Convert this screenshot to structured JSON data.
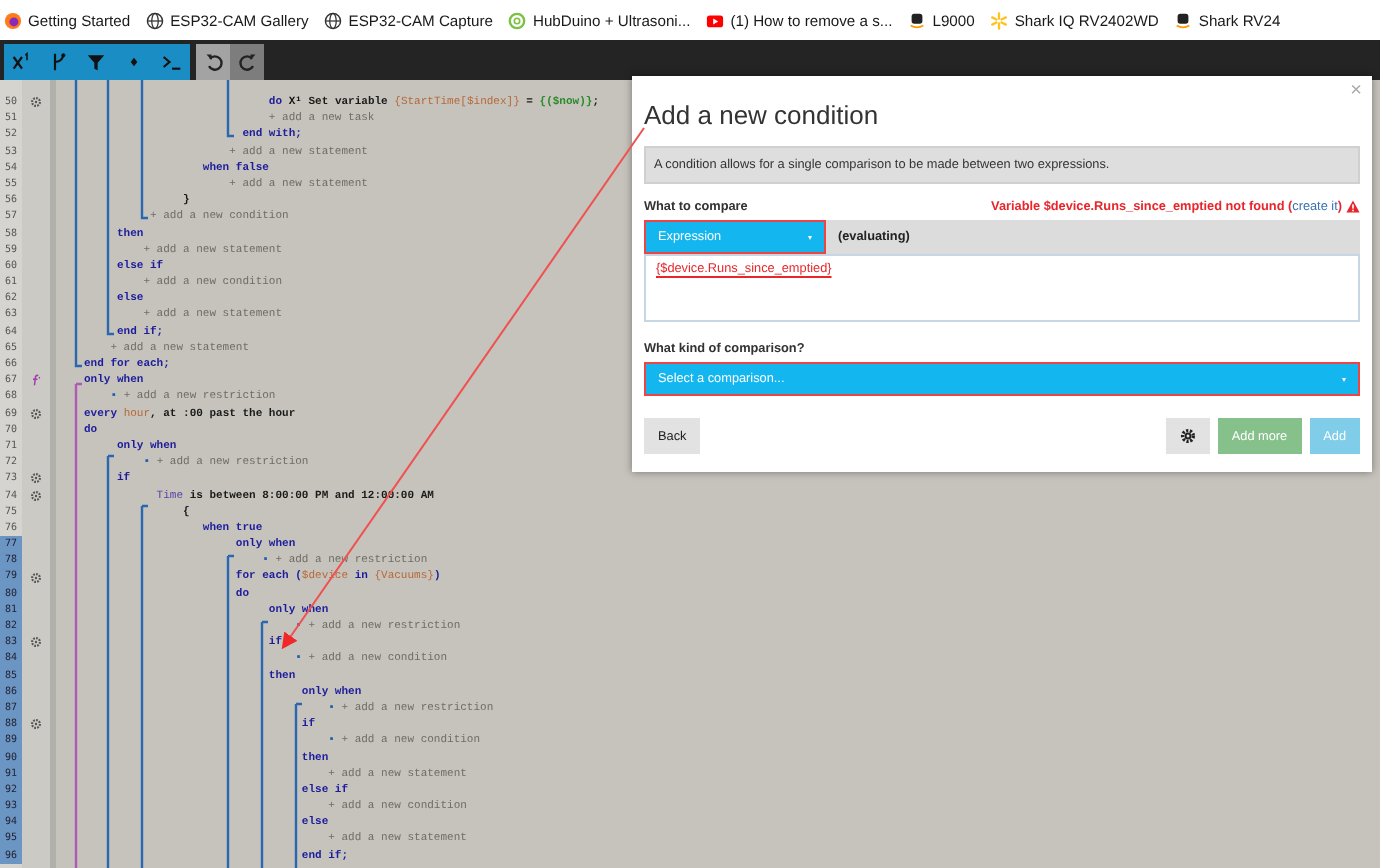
{
  "bookmarks": [
    {
      "kind": "firefox",
      "label": "Getting Started"
    },
    {
      "kind": "globe",
      "label": "ESP32-CAM Gallery"
    },
    {
      "kind": "globe",
      "label": "ESP32-CAM Capture"
    },
    {
      "kind": "ring",
      "label": "HubDuino + Ultrasoni..."
    },
    {
      "kind": "video",
      "label": "(1) How to remove a s..."
    },
    {
      "kind": "amazon",
      "label": "L9000"
    },
    {
      "kind": "spark",
      "label": "Shark IQ RV2402WD"
    },
    {
      "kind": "amazon",
      "label": "Shark RV24"
    }
  ],
  "toolbar": {
    "groups": [
      {
        "kind": "insert",
        "buttons": [
          {
            "kind": "variable"
          },
          {
            "kind": "branch"
          },
          {
            "kind": "filter"
          },
          {
            "kind": "diamond"
          },
          {
            "kind": "terminal"
          }
        ]
      },
      {
        "kind": "history",
        "buttons": [
          {
            "kind": "undo"
          },
          {
            "kind": "redo"
          }
        ]
      }
    ]
  },
  "editor": {
    "lines": [
      {
        "number": "50",
        "marker": {
          "kind": "gear"
        },
        "highlighted": false,
        "parts": [
          {
            "kind": "keyword",
            "text": "                            do "
          },
          {
            "kind": "icon",
            "text": "X¹"
          },
          {
            "kind": "text",
            "text": " Set variable "
          },
          {
            "kind": "var",
            "text": "{StartTime[$index]}"
          },
          {
            "kind": "text",
            "text": " = "
          },
          {
            "kind": "value",
            "text": "{($now)}"
          },
          {
            "kind": "text",
            "text": ";"
          }
        ]
      },
      {
        "number": "51",
        "highlighted": false,
        "parts": [
          {
            "kind": "add",
            "text": "                            + add a new task"
          }
        ]
      },
      {
        "number": "52",
        "highlighted": false,
        "parts": [
          {
            "kind": "keyword",
            "text": "                        end with;"
          }
        ]
      },
      {
        "number": "53",
        "highlighted": false,
        "parts": [
          {
            "kind": "add",
            "text": "                      + add a new statement"
          }
        ]
      },
      {
        "number": "54",
        "highlighted": false,
        "parts": [
          {
            "kind": "keyword",
            "text": "                  when false"
          }
        ]
      },
      {
        "number": "55",
        "highlighted": false,
        "parts": [
          {
            "kind": "add",
            "text": "                      + add a new statement"
          }
        ]
      },
      {
        "number": "56",
        "highlighted": false,
        "parts": [
          {
            "kind": "text",
            "text": "               }"
          }
        ]
      },
      {
        "number": "57",
        "highlighted": false,
        "parts": [
          {
            "kind": "add",
            "text": "          + add a new condition"
          }
        ]
      },
      {
        "number": "58",
        "highlighted": false,
        "parts": [
          {
            "kind": "keyword",
            "text": "     then"
          }
        ]
      },
      {
        "number": "59",
        "highlighted": false,
        "parts": [
          {
            "kind": "add",
            "text": "         + add a new statement"
          }
        ]
      },
      {
        "number": "60",
        "highlighted": false,
        "parts": [
          {
            "kind": "keyword",
            "text": "     else if"
          }
        ]
      },
      {
        "number": "61",
        "highlighted": false,
        "parts": [
          {
            "kind": "add",
            "text": "         + add a new condition"
          }
        ]
      },
      {
        "number": "62",
        "highlighted": false,
        "parts": [
          {
            "kind": "keyword",
            "text": "     else"
          }
        ]
      },
      {
        "number": "63",
        "highlighted": false,
        "parts": [
          {
            "kind": "add",
            "text": "         + add a new statement"
          }
        ]
      },
      {
        "number": "64",
        "highlighted": false,
        "parts": [
          {
            "kind": "keyword",
            "text": "     end if;"
          }
        ]
      },
      {
        "number": "65",
        "highlighted": false,
        "parts": [
          {
            "kind": "add",
            "text": "    + add a new statement"
          }
        ]
      },
      {
        "number": "66",
        "highlighted": false,
        "parts": [
          {
            "kind": "keyword",
            "text": "end for each;"
          }
        ]
      },
      {
        "number": "67",
        "marker": {
          "kind": "function"
        },
        "highlighted": false,
        "parts": [
          {
            "kind": "keyword",
            "text": "only when"
          }
        ]
      },
      {
        "number": "68",
        "highlighted": false,
        "parts": [
          {
            "kind": "bullet",
            "text": "    ▪"
          },
          {
            "kind": "add",
            "text": " + add a new restriction"
          }
        ]
      },
      {
        "number": "69",
        "marker": {
          "kind": "gear"
        },
        "highlighted": false,
        "parts": [
          {
            "kind": "keyword",
            "text": "every "
          },
          {
            "kind": "var",
            "text": "hour"
          },
          {
            "kind": "text",
            "text": ", at :00 past the hour"
          }
        ]
      },
      {
        "number": "70",
        "highlighted": false,
        "parts": [
          {
            "kind": "keyword",
            "text": "do"
          }
        ]
      },
      {
        "number": "71",
        "highlighted": false,
        "parts": [
          {
            "kind": "keyword",
            "text": "     only when"
          }
        ]
      },
      {
        "number": "72",
        "highlighted": false,
        "parts": [
          {
            "kind": "bullet",
            "text": "         ▪"
          },
          {
            "kind": "add",
            "text": " + add a new restriction"
          }
        ]
      },
      {
        "number": "73",
        "marker": {
          "kind": "gear"
        },
        "highlighted": false,
        "parts": [
          {
            "kind": "keyword",
            "text": "     if"
          }
        ]
      },
      {
        "number": "74",
        "marker": {
          "kind": "gear"
        },
        "highlighted": false,
        "parts": [
          {
            "kind": "device",
            "text": "           Time"
          },
          {
            "kind": "text",
            "text": " is between 8:00:00 PM and 12:00:00 AM"
          }
        ]
      },
      {
        "number": "75",
        "highlighted": false,
        "parts": [
          {
            "kind": "text",
            "text": "               {"
          }
        ]
      },
      {
        "number": "76",
        "highlighted": false,
        "parts": [
          {
            "kind": "keyword",
            "text": "                  when true"
          }
        ]
      },
      {
        "number": "77",
        "highlighted": true,
        "parts": [
          {
            "kind": "keyword",
            "text": "                       only when"
          }
        ]
      },
      {
        "number": "78",
        "highlighted": true,
        "parts": [
          {
            "kind": "bullet",
            "text": "                           ▪"
          },
          {
            "kind": "add",
            "text": " + add a new restriction"
          }
        ]
      },
      {
        "number": "79",
        "marker": {
          "kind": "gear"
        },
        "highlighted": true,
        "parts": [
          {
            "kind": "keyword",
            "text": "                       for each ("
          },
          {
            "kind": "var",
            "text": "$device"
          },
          {
            "kind": "keyword",
            "text": " in "
          },
          {
            "kind": "var",
            "text": "{Vacuums}"
          },
          {
            "kind": "keyword",
            "text": ")"
          }
        ]
      },
      {
        "number": "80",
        "highlighted": true,
        "parts": [
          {
            "kind": "keyword",
            "text": "                       do"
          }
        ]
      },
      {
        "number": "81",
        "highlighted": true,
        "parts": [
          {
            "kind": "keyword",
            "text": "                            only when"
          }
        ]
      },
      {
        "number": "82",
        "highlighted": true,
        "parts": [
          {
            "kind": "bullet",
            "text": "                                ▪"
          },
          {
            "kind": "add",
            "text": " + add a new restriction"
          }
        ]
      },
      {
        "number": "83",
        "marker": {
          "kind": "gear"
        },
        "highlighted": true,
        "parts": [
          {
            "kind": "keyword",
            "text": "                            if"
          }
        ]
      },
      {
        "number": "84",
        "highlighted": true,
        "parts": [
          {
            "kind": "bullet",
            "text": "                                ▪"
          },
          {
            "kind": "add",
            "text": " + add a new condition"
          }
        ]
      },
      {
        "number": "85",
        "highlighted": true,
        "parts": [
          {
            "kind": "keyword",
            "text": "                            then"
          }
        ]
      },
      {
        "number": "86",
        "highlighted": true,
        "parts": [
          {
            "kind": "keyword",
            "text": "                                 only when"
          }
        ]
      },
      {
        "number": "87",
        "highlighted": true,
        "parts": [
          {
            "kind": "bullet",
            "text": "                                     ▪"
          },
          {
            "kind": "add",
            "text": " + add a new restriction"
          }
        ]
      },
      {
        "number": "88",
        "marker": {
          "kind": "gear"
        },
        "highlighted": true,
        "parts": [
          {
            "kind": "keyword",
            "text": "                                 if"
          }
        ]
      },
      {
        "number": "89",
        "highlighted": true,
        "parts": [
          {
            "kind": "bullet",
            "text": "                                     ▪"
          },
          {
            "kind": "add",
            "text": " + add a new condition"
          }
        ]
      },
      {
        "number": "90",
        "highlighted": true,
        "parts": [
          {
            "kind": "keyword",
            "text": "                                 then"
          }
        ]
      },
      {
        "number": "91",
        "highlighted": true,
        "parts": [
          {
            "kind": "add",
            "text": "                                     + add a new statement"
          }
        ]
      },
      {
        "number": "92",
        "highlighted": true,
        "parts": [
          {
            "kind": "keyword",
            "text": "                                 else if"
          }
        ]
      },
      {
        "number": "93",
        "highlighted": true,
        "parts": [
          {
            "kind": "add",
            "text": "                                     + add a new condition"
          }
        ]
      },
      {
        "number": "94",
        "highlighted": true,
        "parts": [
          {
            "kind": "keyword",
            "text": "                                 else"
          }
        ]
      },
      {
        "number": "95",
        "highlighted": true,
        "parts": [
          {
            "kind": "add",
            "text": "                                     + add a new statement"
          }
        ]
      },
      {
        "number": "96",
        "highlighted": true,
        "parts": [
          {
            "kind": "keyword",
            "text": "                                 end if;"
          }
        ]
      }
    ]
  },
  "dialog": {
    "title": "Add a new condition",
    "close": "×",
    "info": "A condition allows for a single comparison to be made between two expressions.",
    "compare_label": "What to compare",
    "error": {
      "text": "Variable $device.Runs_since_emptied not found (",
      "link": "create it",
      "end": ")"
    },
    "operand_type": "Expression",
    "evaluation": "(evaluating)",
    "expression": "{$device.Runs_since_emptied}",
    "comparison_label": "What kind of comparison?",
    "comparison_placeholder": "Select a comparison...",
    "buttons": [
      {
        "kind": "default",
        "label": "Back"
      },
      {
        "kind": "settings"
      },
      {
        "kind": "success",
        "label": "Add more"
      },
      {
        "kind": "primary",
        "label": "Add"
      }
    ]
  }
}
